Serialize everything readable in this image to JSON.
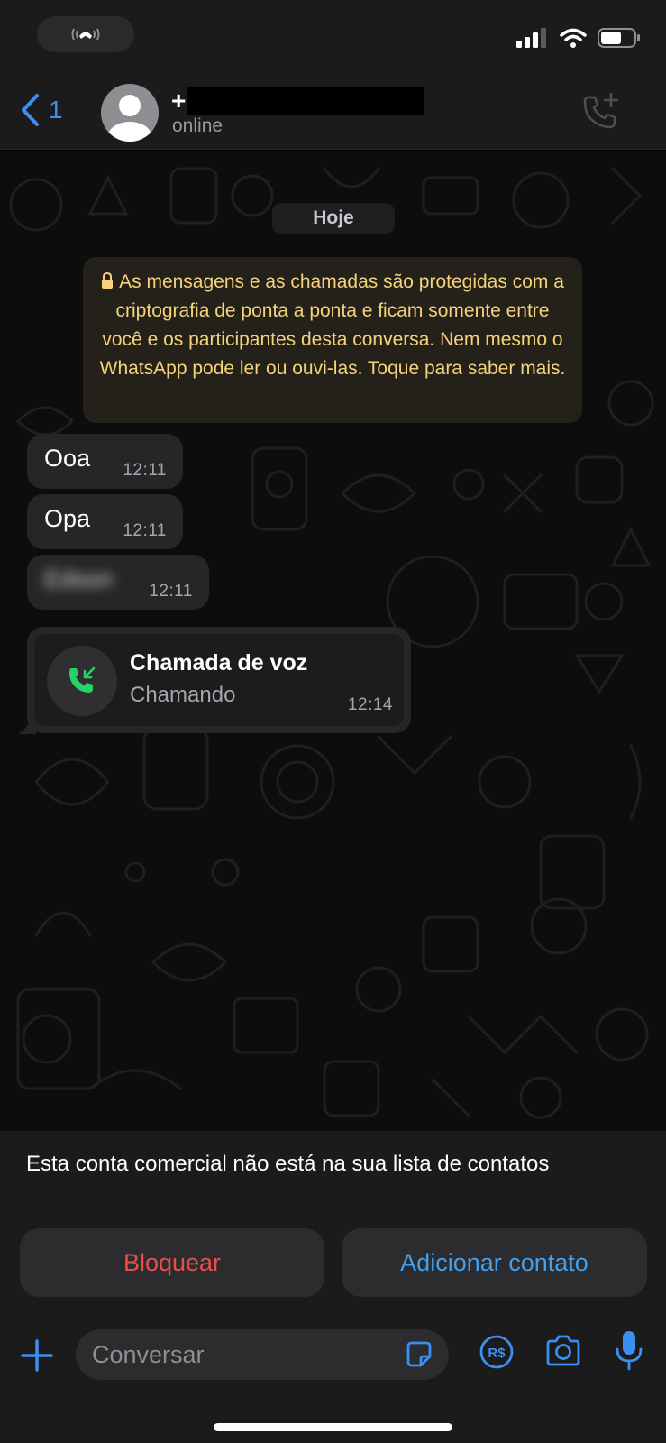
{
  "status_bar": {
    "call_indicator_icon": "phone-handset-icon",
    "signal_icon": "cellular-signal-icon",
    "wifi_icon": "wifi-icon",
    "battery_icon": "battery-icon"
  },
  "header": {
    "back_count": "1",
    "contact_name_prefix": "+",
    "contact_status": "online",
    "avatar_icon": "default-avatar-icon",
    "add_call_icon": "add-call-icon"
  },
  "chat": {
    "date_label": "Hoje",
    "encryption_notice": "As mensagens e as chamadas são protegidas com a criptografia de ponta a ponta e ficam somente entre você e os participantes desta conversa. Nem mesmo o WhatsApp pode ler ou ouvi-las. Toque para saber mais.",
    "messages": [
      {
        "text": "Ooa",
        "time": "12:11"
      },
      {
        "text": "Opa",
        "time": "12:11"
      },
      {
        "text": "Edson",
        "time": "12:11"
      }
    ],
    "voice_call": {
      "title": "Chamada de voz",
      "status": "Chamando",
      "time": "12:14"
    }
  },
  "business_banner": {
    "text": "Esta conta comercial não está na sua lista de contatos",
    "block_label": "Bloquear",
    "add_contact_label": "Adicionar contato"
  },
  "input_bar": {
    "placeholder": "Conversar"
  },
  "colors": {
    "accent_blue": "#3a8ff0",
    "block_red": "#eb4d4b",
    "notice_yellow": "#f6d27a",
    "call_green": "#25d366"
  }
}
